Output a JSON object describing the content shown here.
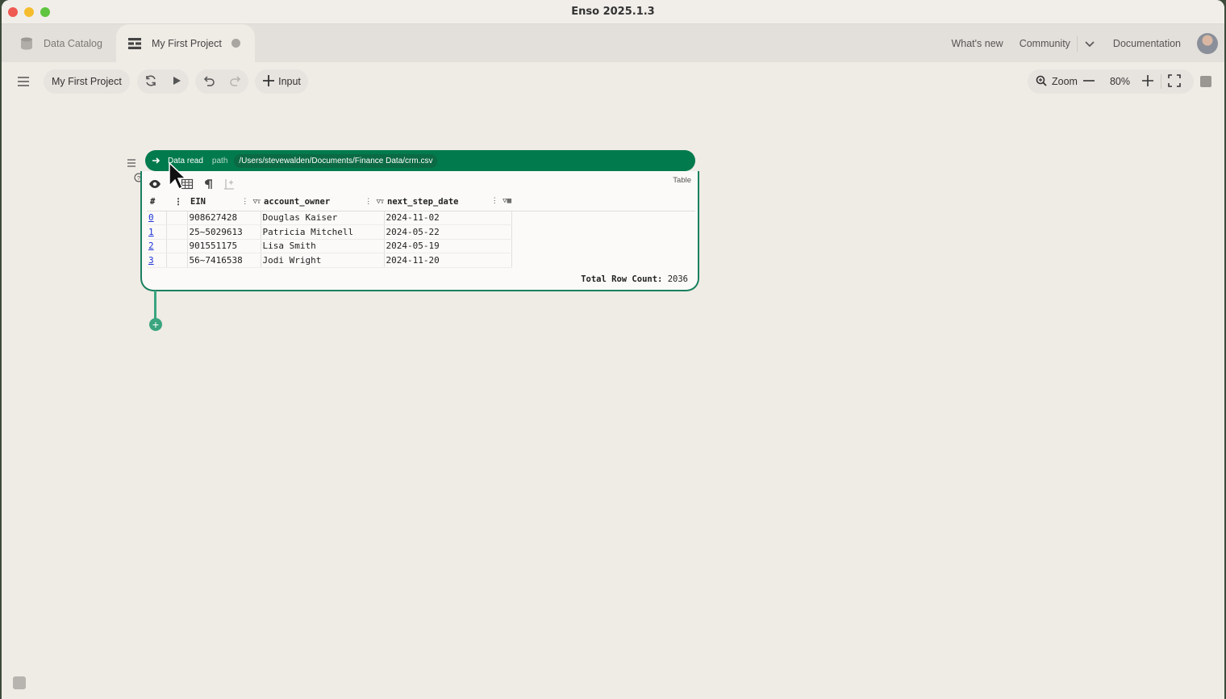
{
  "window": {
    "title": "Enso 2025.1.3"
  },
  "tabs": {
    "catalog": "Data Catalog",
    "project": "My First Project"
  },
  "links": {
    "whats_new": "What's new",
    "community": "Community",
    "documentation": "Documentation"
  },
  "toolbar": {
    "project_name": "My First Project",
    "input_label": "Input",
    "zoom_label": "Zoom",
    "zoom_value": "80%"
  },
  "node": {
    "name": "Data read",
    "arg_name": "path",
    "path": "/Users/stevewalden/Documents/Finance Data/crm.csv",
    "viz_type": "Table",
    "columns": [
      "#",
      "EIN",
      "account_owner",
      "next_step_date"
    ],
    "rows": [
      {
        "idx": "0",
        "ein": "908627428",
        "owner": "Douglas Kaiser",
        "date": "2024-11-02"
      },
      {
        "idx": "1",
        "ein": "25~5029613",
        "owner": "Patricia Mitchell",
        "date": "2024-05-22"
      },
      {
        "idx": "2",
        "ein": "901551175",
        "owner": "Lisa Smith",
        "date": "2024-05-19"
      },
      {
        "idx": "3",
        "ein": "56~7416538",
        "owner": "Jodi Wright",
        "date": "2024-11-20"
      }
    ],
    "row_count_label": "Total Row Count:",
    "row_count": "2036"
  }
}
